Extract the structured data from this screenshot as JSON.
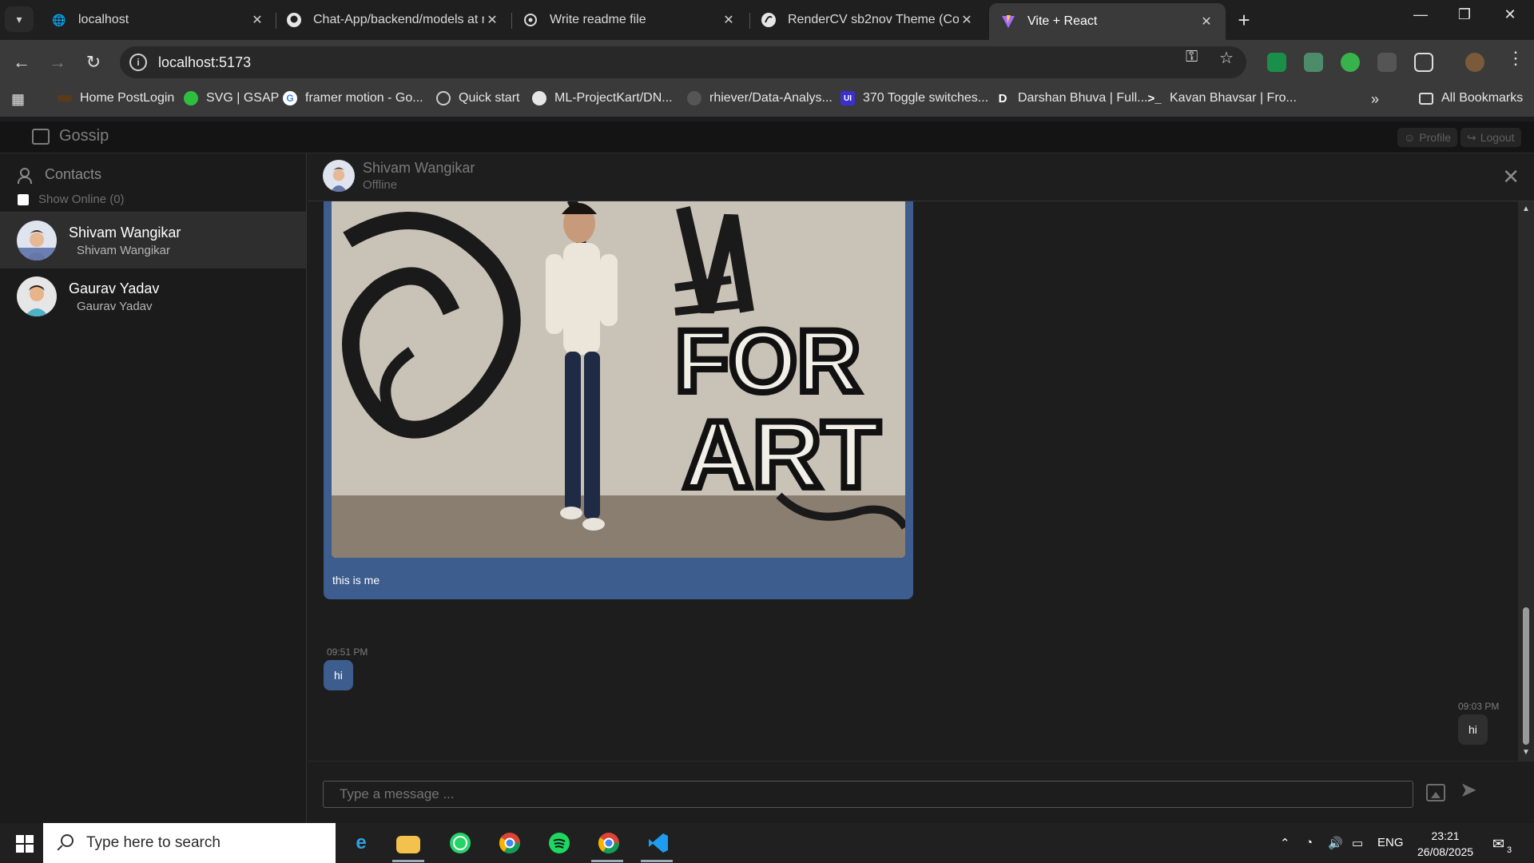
{
  "browser": {
    "tabs": [
      {
        "title": "localhost",
        "favicon": "globe-icon",
        "active": false
      },
      {
        "title": "Chat-App/backend/models at m",
        "favicon": "github-icon",
        "active": false
      },
      {
        "title": "Write readme file",
        "favicon": "openai-icon",
        "active": false
      },
      {
        "title": "RenderCV sb2nov Theme (Copy",
        "favicon": "overleaf-icon",
        "active": false
      },
      {
        "title": "Vite + React",
        "favicon": "vite-icon",
        "active": true
      }
    ],
    "url": "localhost:5173",
    "bookmarks": [
      {
        "label": "Home PostLogin"
      },
      {
        "label": "SVG | GSAP"
      },
      {
        "label": "framer motion - Go..."
      },
      {
        "label": "Quick start"
      },
      {
        "label": "ML-ProjectKart/DN..."
      },
      {
        "label": "rhiever/Data-Analys..."
      },
      {
        "label": "370 Toggle switches..."
      },
      {
        "label": "Darshan Bhuva | Full..."
      },
      {
        "label": "Kavan Bhavsar | Fro..."
      }
    ],
    "all_bookmarks": "All Bookmarks"
  },
  "app": {
    "brand": "Gossip",
    "profile_label": "Profile",
    "logout_label": "Logout",
    "sidebar": {
      "title": "Contacts",
      "show_online": "Show Online (0)",
      "contacts": [
        {
          "name": "Shivam Wangikar",
          "subtitle": "Shivam Wangikar",
          "selected": true
        },
        {
          "name": "Gaurav Yadav",
          "subtitle": "Gaurav Yadav",
          "selected": false
        }
      ]
    },
    "chat": {
      "name": "Shivam Wangikar",
      "status": "Offline",
      "messages": [
        {
          "type": "image",
          "caption": "this is me",
          "direction": "incoming"
        },
        {
          "time": "09:51 PM",
          "text": "hi",
          "direction": "incoming"
        },
        {
          "time": "09:03 PM",
          "text": "hi",
          "direction": "outgoing"
        }
      ],
      "input_placeholder": "Type a message ..."
    }
  },
  "taskbar": {
    "search_placeholder": "Type here to search",
    "language": "ENG",
    "time": "23:21",
    "date": "26/08/2025",
    "notifications": "3"
  }
}
